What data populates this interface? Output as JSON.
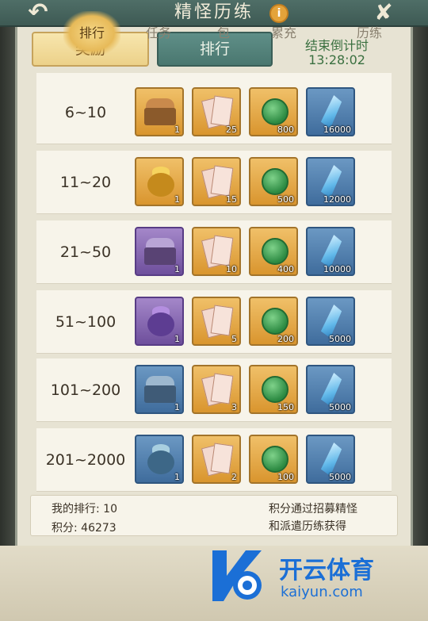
{
  "header": {
    "title": "精怪历练",
    "back_icon": "back-arrow-icon",
    "info_icon": "info-icon",
    "info_glyph": "i",
    "close_icon": "close-icon"
  },
  "tabs": [
    {
      "label": "奖励",
      "active": true
    },
    {
      "label": "排行",
      "active": false
    }
  ],
  "countdown": {
    "label": "结束倒计时",
    "time": "13:28:02"
  },
  "rewards": [
    {
      "rank": "6~10",
      "items": [
        {
          "icon": "bronze-chest-icon",
          "count": "1",
          "frame": "gold"
        },
        {
          "icon": "summon-scroll-icon",
          "count": "25",
          "frame": "gold"
        },
        {
          "icon": "jade-coin-icon",
          "count": "800",
          "frame": "gold"
        },
        {
          "icon": "blue-crystal-icon",
          "count": "16000",
          "frame": "blue"
        }
      ]
    },
    {
      "rank": "11~20",
      "items": [
        {
          "icon": "gold-bag-icon",
          "count": "1",
          "frame": "gold"
        },
        {
          "icon": "summon-scroll-icon",
          "count": "15",
          "frame": "gold"
        },
        {
          "icon": "jade-coin-icon",
          "count": "500",
          "frame": "gold"
        },
        {
          "icon": "blue-crystal-icon",
          "count": "12000",
          "frame": "blue"
        }
      ]
    },
    {
      "rank": "21~50",
      "items": [
        {
          "icon": "purple-chest-icon",
          "count": "1",
          "frame": "purple"
        },
        {
          "icon": "summon-scroll-icon",
          "count": "10",
          "frame": "gold"
        },
        {
          "icon": "jade-coin-icon",
          "count": "400",
          "frame": "gold"
        },
        {
          "icon": "blue-crystal-icon",
          "count": "10000",
          "frame": "blue"
        }
      ]
    },
    {
      "rank": "51~100",
      "items": [
        {
          "icon": "purple-bag-icon",
          "count": "1",
          "frame": "purple"
        },
        {
          "icon": "summon-scroll-icon",
          "count": "5",
          "frame": "gold"
        },
        {
          "icon": "jade-coin-icon",
          "count": "200",
          "frame": "gold"
        },
        {
          "icon": "blue-crystal-icon",
          "count": "5000",
          "frame": "blue"
        }
      ]
    },
    {
      "rank": "101~200",
      "items": [
        {
          "icon": "blue-chest-icon",
          "count": "1",
          "frame": "blue"
        },
        {
          "icon": "summon-scroll-icon",
          "count": "3",
          "frame": "gold"
        },
        {
          "icon": "jade-coin-icon",
          "count": "150",
          "frame": "gold"
        },
        {
          "icon": "blue-crystal-icon",
          "count": "5000",
          "frame": "blue"
        }
      ]
    },
    {
      "rank": "201~2000",
      "items": [
        {
          "icon": "blue-bag-icon",
          "count": "1",
          "frame": "blue"
        },
        {
          "icon": "summon-scroll-icon",
          "count": "2",
          "frame": "gold"
        },
        {
          "icon": "jade-coin-icon",
          "count": "100",
          "frame": "gold"
        },
        {
          "icon": "blue-crystal-icon",
          "count": "5000",
          "frame": "blue"
        }
      ]
    }
  ],
  "my_info": {
    "rank_label": "我的排行: 10",
    "score_label": "积分: 46273",
    "hint_line1": "积分通过招募精怪",
    "hint_line2": "和派遣历练获得"
  },
  "bottom_nav": [
    {
      "label": "排行",
      "active": true
    },
    {
      "label": "任务",
      "active": false
    },
    {
      "label": "包",
      "active": false
    },
    {
      "label": "累充",
      "active": false
    },
    {
      "label": "历练",
      "active": false
    }
  ],
  "watermark": {
    "brand": "开云体育",
    "url": "kaiyun.com"
  },
  "colors": {
    "header_bg": "#4f6e67",
    "active_tab": "#ecd189",
    "inactive_tab": "#4a776f",
    "countdown_text": "#3a7040",
    "brand_blue": "#1b6fd6"
  }
}
